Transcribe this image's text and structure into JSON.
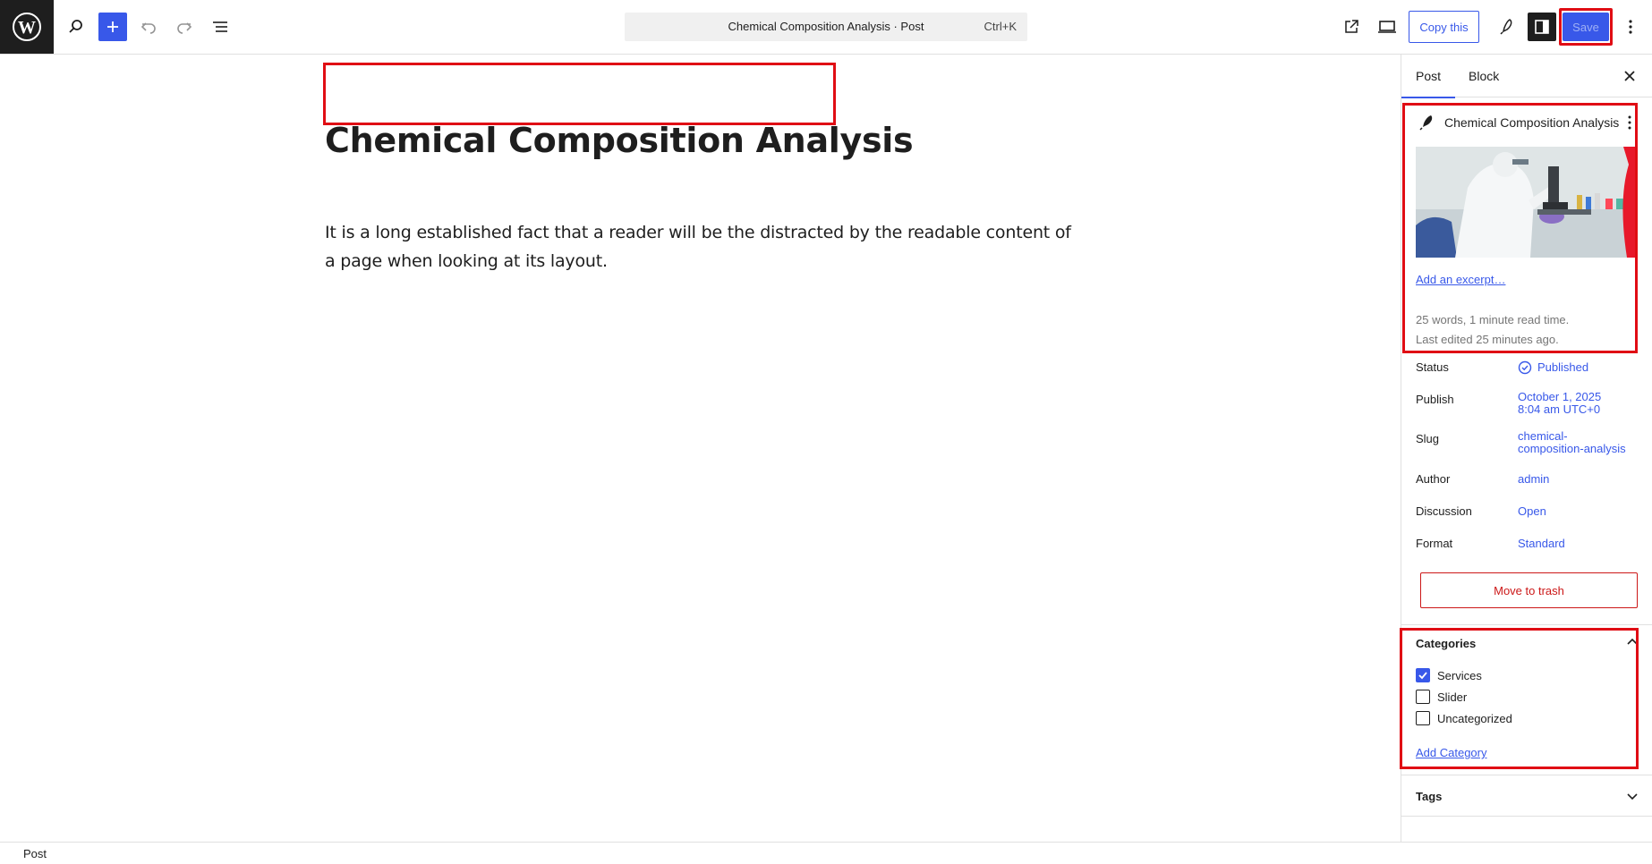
{
  "toolbar": {
    "command_title": "Chemical Composition Analysis · Post",
    "command_shortcut": "Ctrl+K",
    "copy_label": "Copy this",
    "save_label": "Save"
  },
  "editor": {
    "title": "Chemical Composition Analysis",
    "paragraph": "It is a long established fact that a reader will be the distracted by the readable content of a page when looking at its layout."
  },
  "sidebar": {
    "tabs": [
      "Post",
      "Block"
    ],
    "summary": {
      "title": "Chemical Composition Analysis",
      "excerpt_link": "Add an excerpt…",
      "word_count": "25 words, 1 minute read time.",
      "last_edited": "Last edited 25 minutes ago."
    },
    "rows": [
      {
        "label": "Status",
        "value": "Published"
      },
      {
        "label": "Publish",
        "value_line1": "October 1, 2025",
        "value_line2": "8:04 am UTC+0"
      },
      {
        "label": "Slug",
        "value_line1": "chemical-",
        "value_line2": "composition-analysis"
      },
      {
        "label": "Author",
        "value": "admin"
      },
      {
        "label": "Discussion",
        "value": "Open"
      },
      {
        "label": "Format",
        "value": "Standard"
      }
    ],
    "trash_label": "Move to trash",
    "categories": {
      "title": "Categories",
      "items": [
        {
          "label": "Services",
          "checked": true
        },
        {
          "label": "Slider",
          "checked": false
        },
        {
          "label": "Uncategorized",
          "checked": false
        }
      ],
      "add_label": "Add Category"
    },
    "tags_title": "Tags"
  },
  "footer": {
    "breadcrumb": "Post"
  },
  "icons": [
    "wordpress-logo-icon",
    "search-icon",
    "plus-icon",
    "undo-icon",
    "redo-icon",
    "list-view-icon",
    "external-link-icon",
    "desktop-preview-icon",
    "pen-style-icon",
    "sidebar-toggle-icon",
    "more-vertical-icon",
    "close-icon",
    "feather-icon",
    "check-circle-icon",
    "chevron-up-icon",
    "chevron-down-icon",
    "checkbox-check-icon"
  ],
  "colors": {
    "accent": "#3858e9",
    "highlight": "#e00d14",
    "danger": "#cc1818",
    "dark": "#1e1e1e"
  }
}
